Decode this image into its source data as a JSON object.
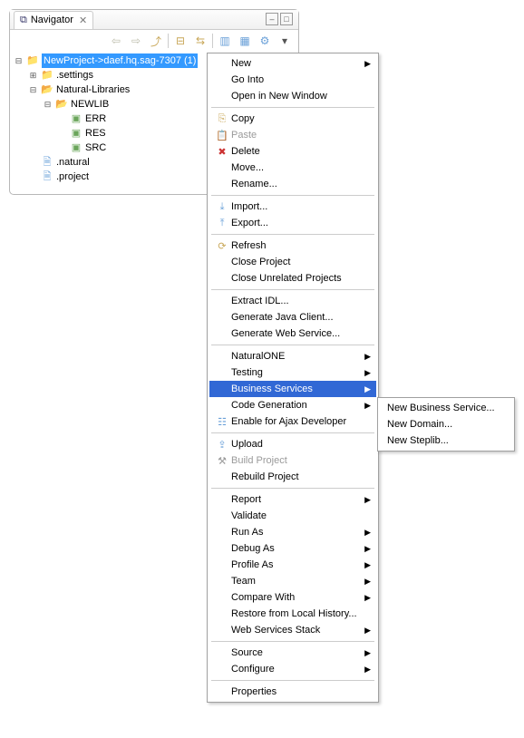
{
  "view": {
    "tab_title": "Navigator"
  },
  "tree": {
    "root": "NewProject->daef.hq.sag-7307 (1)",
    "settings": ".settings",
    "natlib": "Natural-Libraries",
    "newlib": "NEWLIB",
    "err": "ERR",
    "res": "RES",
    "src": "SRC",
    "natural": ".natural",
    "project": ".project"
  },
  "menu": {
    "new": "New",
    "go_into": "Go Into",
    "open_new_window": "Open in New Window",
    "copy": "Copy",
    "paste": "Paste",
    "delete": "Delete",
    "move": "Move...",
    "rename": "Rename...",
    "import": "Import...",
    "export": "Export...",
    "refresh": "Refresh",
    "close_project": "Close Project",
    "close_unrelated": "Close Unrelated Projects",
    "extract_idl": "Extract IDL...",
    "gen_java": "Generate Java Client...",
    "gen_web": "Generate Web Service...",
    "naturalone": "NaturalONE",
    "testing": "Testing",
    "business_services": "Business Services",
    "code_generation": "Code Generation",
    "enable_ajax": "Enable for Ajax Developer",
    "upload": "Upload",
    "build_project": "Build Project",
    "rebuild_project": "Rebuild Project",
    "report": "Report",
    "validate": "Validate",
    "run_as": "Run As",
    "debug_as": "Debug As",
    "profile_as": "Profile As",
    "team": "Team",
    "compare_with": "Compare With",
    "restore_history": "Restore from Local History...",
    "web_services_stack": "Web Services Stack",
    "source": "Source",
    "configure": "Configure",
    "properties": "Properties"
  },
  "submenu": {
    "new_bs": "New Business Service...",
    "new_domain": "New Domain...",
    "new_steplib": "New Steplib..."
  }
}
